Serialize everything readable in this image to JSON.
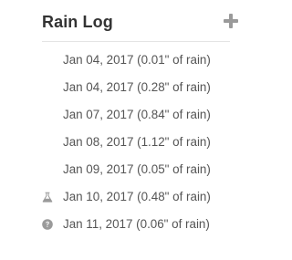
{
  "panel": {
    "title": "Rain Log",
    "add_icon": "plus-icon",
    "colors": {
      "title": "#333333",
      "text": "#555555",
      "icon": "#9a9a9a",
      "divider": "#e4e4e4"
    }
  },
  "entries": [
    {
      "label": "Jan 04, 2017 (0.01\" of rain)",
      "icon": "none"
    },
    {
      "label": "Jan 04, 2017 (0.28\" of rain)",
      "icon": "none"
    },
    {
      "label": "Jan 07, 2017 (0.84\" of rain)",
      "icon": "none"
    },
    {
      "label": "Jan 08, 2017 (1.12\" of rain)",
      "icon": "none"
    },
    {
      "label": "Jan 09, 2017 (0.05\" of rain)",
      "icon": "none"
    },
    {
      "label": "Jan 10, 2017 (0.48\" of rain)",
      "icon": "flask-icon"
    },
    {
      "label": "Jan 11, 2017 (0.06\" of rain)",
      "icon": "question-circle-icon"
    }
  ]
}
